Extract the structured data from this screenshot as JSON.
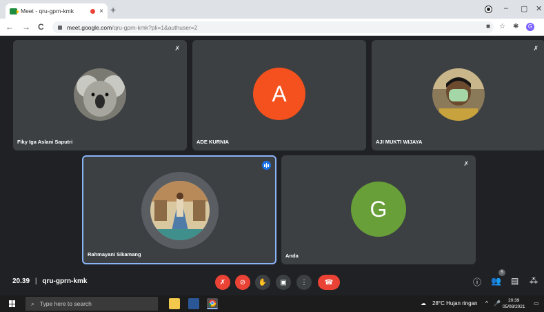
{
  "browser": {
    "tab_title": "Meet - qru-gprn-kmk",
    "tab_close": "×",
    "new_tab": "+",
    "window_controls": {
      "minimize": "–",
      "maximize": "▢",
      "close": "✕"
    },
    "nav": {
      "back": "←",
      "forward": "→",
      "reload": "C"
    },
    "url_host": "meet.google.com",
    "url_path": "/qru-gprn-kmk?pli=1&authuser=2",
    "profile_initial": "G"
  },
  "participants": [
    {
      "name": "Fiky Iga Aslani Saputri",
      "muted": true,
      "avatar": "koala-photo"
    },
    {
      "name": "ADE KURNIA",
      "muted": false,
      "avatar_letter": "A",
      "avatar_color": "#f4511e"
    },
    {
      "name": "AJI MUKTI WIJAYA",
      "muted": true,
      "avatar": "masked-person-photo"
    },
    {
      "name": "Rahmayani Sikamang",
      "speaking": true,
      "avatar": "scene-photo"
    },
    {
      "name": "Anda",
      "muted": true,
      "avatar_letter": "G",
      "avatar_color": "#689f38"
    }
  ],
  "meeting": {
    "time": "20.39",
    "separator": "|",
    "code": "qru-gprn-kmk",
    "people_count": "5"
  },
  "taskbar": {
    "search_placeholder": "Type here to search",
    "weather": "28°C  Hujan ringan",
    "time": "20:39",
    "date": "05/08/2021"
  },
  "colors": {
    "meet_bg": "#202124",
    "tile_bg": "#3c4043",
    "danger": "#ea4335",
    "active_border": "#8ab4f8"
  }
}
